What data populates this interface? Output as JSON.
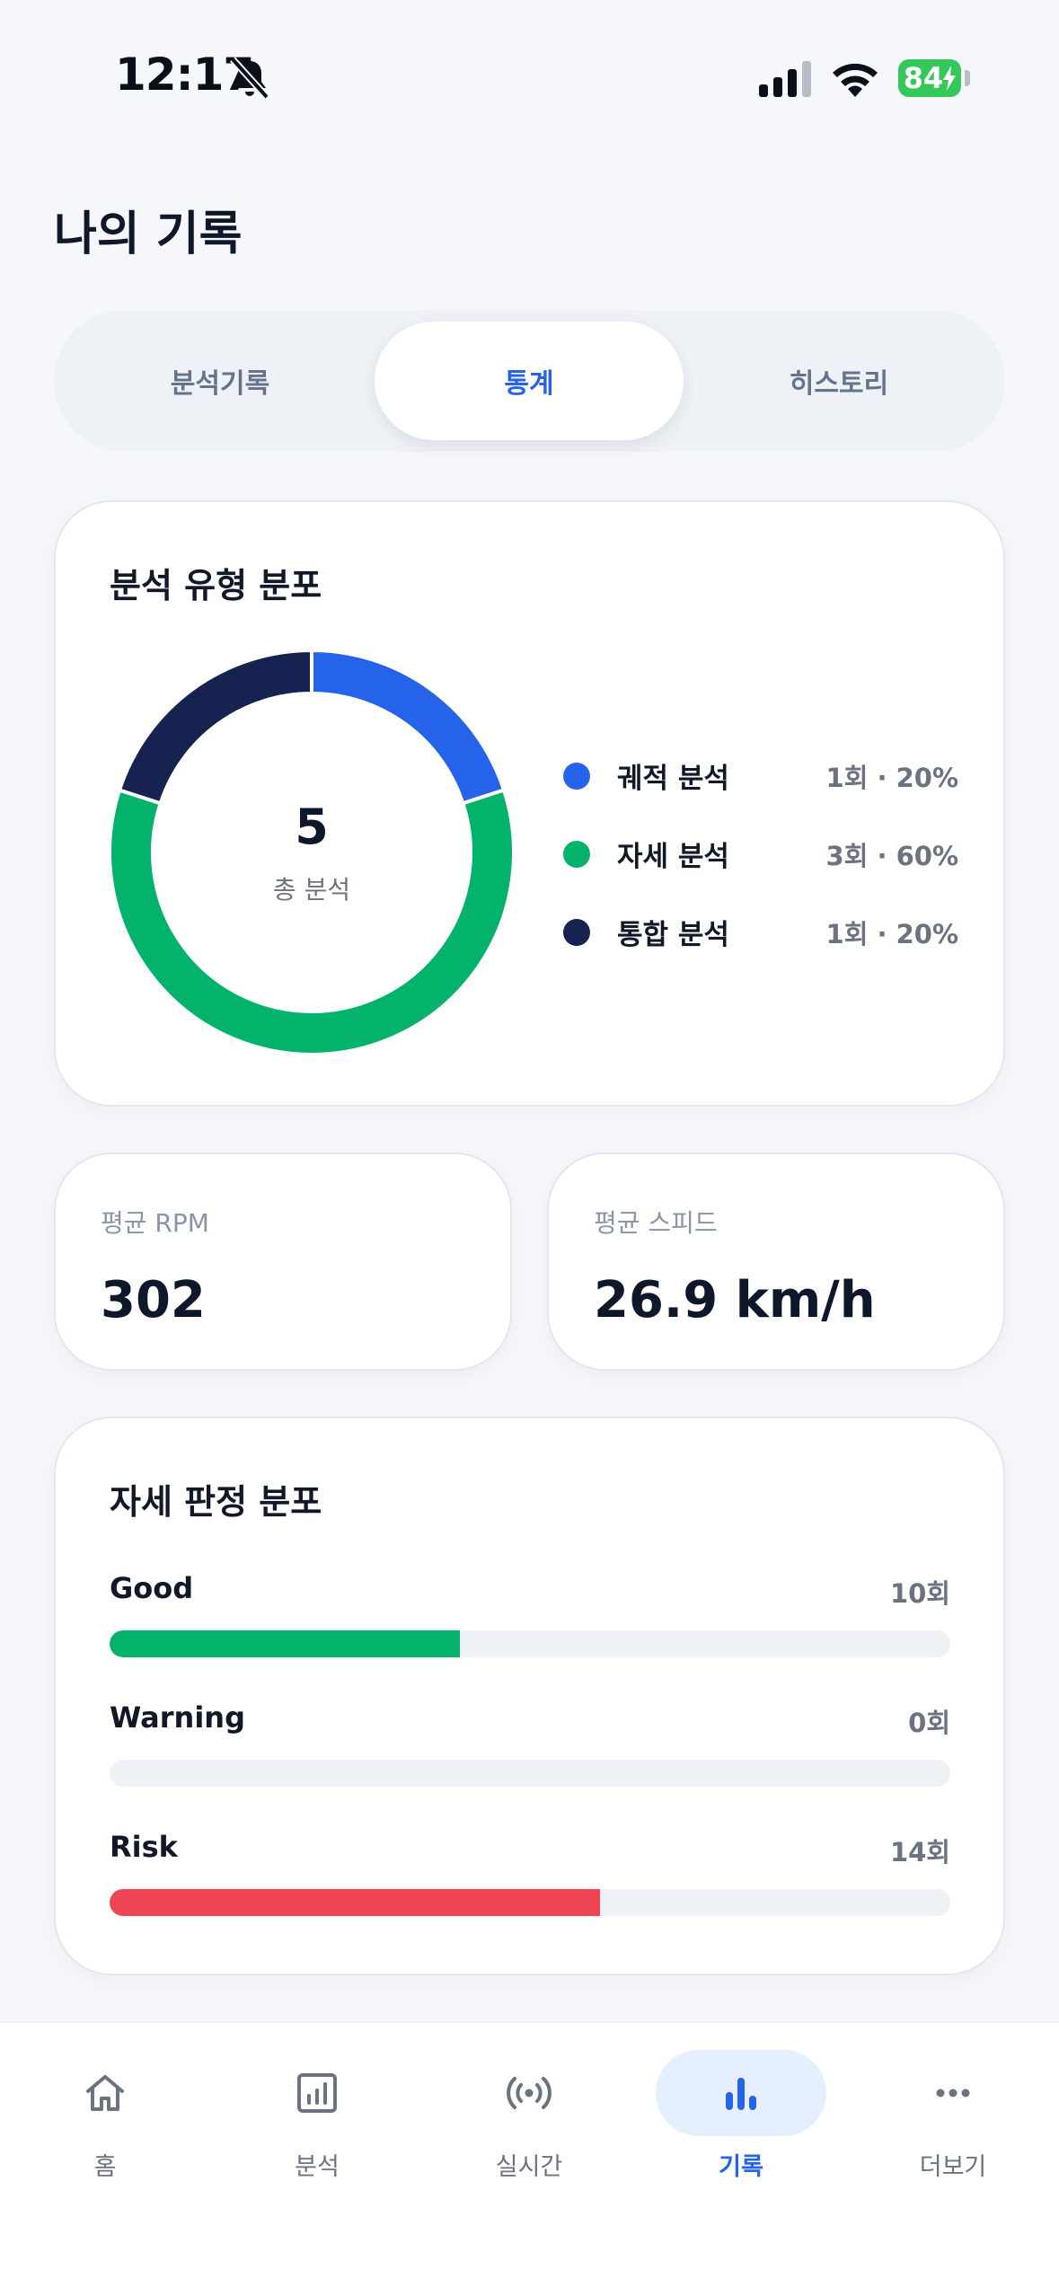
{
  "status_bar": {
    "time": "12:17",
    "battery": "84",
    "icons": [
      "bell-slash-icon",
      "cellular-signal-icon",
      "wifi-icon",
      "battery-charging-icon"
    ]
  },
  "page": {
    "title": "나의 기록"
  },
  "tabs": [
    {
      "label": "분석기록",
      "active": false
    },
    {
      "label": "통계",
      "active": true
    },
    {
      "label": "히스토리",
      "active": false
    }
  ],
  "analysis_distribution": {
    "title": "분석 유형 분포",
    "total_value": "5",
    "total_label": "총 분석",
    "legend": [
      {
        "name": "궤적 분석",
        "value": "1회 · 20%"
      },
      {
        "name": "자세 분석",
        "value": "3회 · 60%"
      },
      {
        "name": "통합 분석",
        "value": "1회 · 20%"
      }
    ]
  },
  "stats": [
    {
      "label": "평균 RPM",
      "value": "302"
    },
    {
      "label": "평균 스피드",
      "value": "26.9 km/h"
    }
  ],
  "posture": {
    "title": "자세 판정 분포",
    "rows": [
      {
        "label": "Good",
        "count": "10회"
      },
      {
        "label": "Warning",
        "count": "0회"
      },
      {
        "label": "Risk",
        "count": "14회"
      }
    ]
  },
  "bottom_nav": [
    {
      "label": "홈",
      "icon": "home-icon",
      "active": false
    },
    {
      "label": "분석",
      "icon": "bar-chart-square-icon",
      "active": false
    },
    {
      "label": "실시간",
      "icon": "broadcast-icon",
      "active": false
    },
    {
      "label": "기록",
      "icon": "stats-bars-icon",
      "active": true
    },
    {
      "label": "더보기",
      "icon": "more-dots-icon",
      "active": false
    }
  ],
  "colors": {
    "accent": "#2563eb",
    "trajectory": "#2563eb",
    "posture": "#04b36b",
    "combined": "#16224f",
    "good": "#04b36b",
    "warning": "#f59e0b",
    "risk": "#ef4453"
  },
  "chart_data": [
    {
      "type": "pie",
      "categories": [
        "궤적 분석",
        "자세 분석",
        "통합 분석"
      ],
      "values": [
        1,
        3,
        1
      ],
      "percent": [
        20,
        60,
        20
      ]
    },
    {
      "type": "bar",
      "categories": [
        "Good",
        "Warning",
        "Risk"
      ],
      "values": [
        10,
        0,
        14
      ],
      "xlim": [
        0,
        24
      ]
    }
  ]
}
